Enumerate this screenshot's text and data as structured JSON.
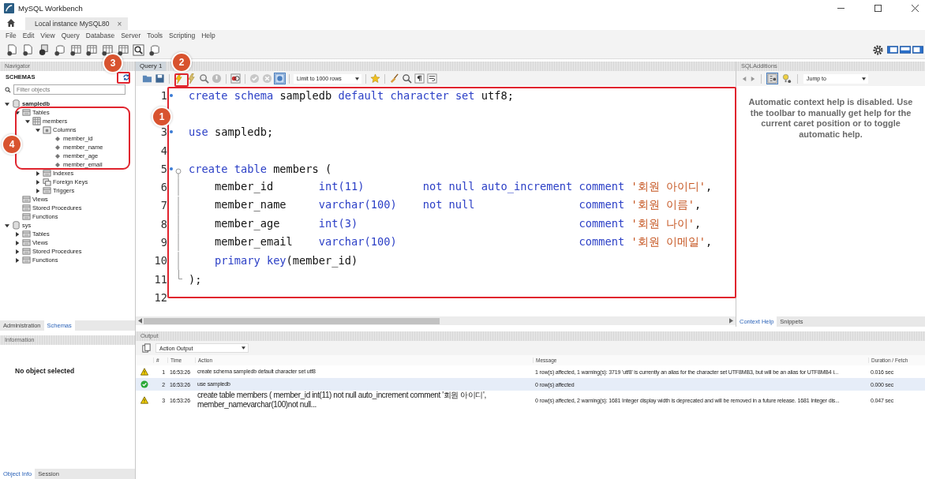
{
  "window": {
    "title": "MySQL Workbench"
  },
  "connection_tabs": [
    {
      "label": "Local instance MySQL80",
      "close": "×",
      "selected": true
    }
  ],
  "menu": [
    "File",
    "Edit",
    "View",
    "Query",
    "Database",
    "Server",
    "Tools",
    "Scripting",
    "Help"
  ],
  "navigator": {
    "title": "Navigator",
    "section": "SCHEMAS",
    "filter": {
      "placeholder": "Filter objects"
    },
    "tree": [
      {
        "label": "sampledb",
        "kind": "schema",
        "active": true,
        "expanded": true,
        "children": [
          {
            "label": "Tables",
            "kind": "folder",
            "expanded": true,
            "children": [
              {
                "label": "members",
                "kind": "table",
                "expanded": true,
                "children": [
                  {
                    "label": "Columns",
                    "kind": "columns",
                    "expanded": true,
                    "children": [
                      {
                        "label": "member_id",
                        "kind": "column"
                      },
                      {
                        "label": "member_name",
                        "kind": "column"
                      },
                      {
                        "label": "member_age",
                        "kind": "column"
                      },
                      {
                        "label": "member_email",
                        "kind": "column"
                      }
                    ]
                  },
                  {
                    "label": "Indexes",
                    "kind": "folder",
                    "expanded": false
                  },
                  {
                    "label": "Foreign Keys",
                    "kind": "keys",
                    "expanded": false
                  },
                  {
                    "label": "Triggers",
                    "kind": "folder",
                    "expanded": false
                  }
                ]
              }
            ]
          },
          {
            "label": "Views",
            "kind": "folder"
          },
          {
            "label": "Stored Procedures",
            "kind": "folder"
          },
          {
            "label": "Functions",
            "kind": "folder"
          }
        ]
      },
      {
        "label": "sys",
        "kind": "schema",
        "active": false,
        "expanded": true,
        "children": [
          {
            "label": "Tables",
            "kind": "folder",
            "expanded": false
          },
          {
            "label": "Views",
            "kind": "folder",
            "expanded": false
          },
          {
            "label": "Stored Procedures",
            "kind": "folder",
            "expanded": false
          },
          {
            "label": "Functions",
            "kind": "folder",
            "expanded": false
          }
        ]
      }
    ],
    "tabs": [
      {
        "label": "Administration",
        "selected": false
      },
      {
        "label": "Schemas",
        "selected": true
      }
    ]
  },
  "information": {
    "title": "Information",
    "message": "No object selected",
    "tabs": [
      {
        "label": "Object Info",
        "selected": true
      },
      {
        "label": "Session",
        "selected": false
      }
    ]
  },
  "editor": {
    "tab": "Query 1",
    "limit": "Limit to 1000 rows",
    "lines": [
      {
        "number": "1",
        "marker": true,
        "kind": "plain",
        "segments": [
          {
            "text": "create schema",
            "kind": "keyword"
          },
          {
            "text": " sampledb ",
            "kind": "plain"
          },
          {
            "text": "default character set",
            "kind": "keyword"
          },
          {
            "text": " utf8;",
            "kind": "plain"
          }
        ]
      },
      {
        "marker": false,
        "kind": "plain"
      },
      {
        "number": "3",
        "marker": true,
        "kind": "plain",
        "segments": [
          {
            "text": "use",
            "kind": "keyword"
          },
          {
            "text": " sampledb;",
            "kind": "plain"
          }
        ]
      },
      {
        "number": "4",
        "marker": false,
        "kind": "plain"
      },
      {
        "number": "5",
        "marker": true,
        "kind": "fold_start",
        "segments": [
          {
            "text": "create table",
            "kind": "keyword"
          },
          {
            "text": " members (",
            "kind": "plain"
          }
        ]
      },
      {
        "number": "6",
        "marker": false,
        "kind": "fold_body",
        "segments": [
          {
            "text": "    member_id       ",
            "kind": "plain"
          },
          {
            "text": "int(11)         not null auto_increment comment ",
            "kind": "keyword"
          },
          {
            "text": "'회원 아이디'",
            "kind": "string"
          },
          {
            "text": ",",
            "kind": "plain"
          }
        ]
      },
      {
        "number": "7",
        "marker": false,
        "kind": "fold_body",
        "segments": [
          {
            "text": "    member_name     ",
            "kind": "plain"
          },
          {
            "text": "varchar(100)    not null                comment ",
            "kind": "keyword"
          },
          {
            "text": "'회원 이름'",
            "kind": "string"
          },
          {
            "text": ",",
            "kind": "plain"
          }
        ]
      },
      {
        "number": "8",
        "marker": false,
        "kind": "fold_body",
        "segments": [
          {
            "text": "    member_age      ",
            "kind": "plain"
          },
          {
            "text": "int(3)                                  comment ",
            "kind": "keyword"
          },
          {
            "text": "'회원 나이'",
            "kind": "string"
          },
          {
            "text": ",",
            "kind": "plain"
          }
        ]
      },
      {
        "number": "9",
        "marker": false,
        "kind": "fold_body",
        "segments": [
          {
            "text": "    member_email    ",
            "kind": "plain"
          },
          {
            "text": "varchar(100)                            comment ",
            "kind": "keyword"
          },
          {
            "text": "'회원 이메일'",
            "kind": "string"
          },
          {
            "text": ",",
            "kind": "plain"
          }
        ]
      },
      {
        "number": "10",
        "marker": false,
        "kind": "fold_body",
        "segments": [
          {
            "text": "    primary key",
            "kind": "keyword"
          },
          {
            "text": "(member_id)",
            "kind": "plain"
          }
        ]
      },
      {
        "number": "11",
        "marker": false,
        "kind": "fold_end",
        "segments": [
          {
            "text": ");",
            "kind": "plain"
          }
        ]
      },
      {
        "number": "12",
        "marker": false,
        "kind": "plain"
      }
    ]
  },
  "output": {
    "title": "Output",
    "mode": "Action Output",
    "columns": [
      "#",
      "Time",
      "Action",
      "Message",
      "Duration / Fetch"
    ],
    "rows": [
      {
        "kind": "warning",
        "selected": false,
        "number": "1",
        "time": "16:53:26",
        "action": "create schema sampledb default character set utf8",
        "message": "1 row(s) affected, 1 warning(s): 3719 'utf8' is currently an alias for the character set UTF8MB3, but will be an alias for UTF8MB4 i...",
        "duration": "0.016 sec"
      },
      {
        "kind": "ok",
        "selected": true,
        "number": "2",
        "time": "16:53:26",
        "action": "use sampledb",
        "message": "0 row(s) affected",
        "duration": "0.000 sec"
      },
      {
        "kind": "warning",
        "selected": false,
        "number": "3",
        "time": "16:53:26",
        "action": "create table members ( member_id int(11) not null auto_increment comment '회원 아이디',        member_namevarchar(100)not null...",
        "message": "0 row(s) affected, 2 warning(s): 1681 Integer display width is deprecated and will be removed in a future release. 1681 Integer dis...",
        "duration": "0.047 sec"
      }
    ]
  },
  "sql_additions": {
    "title": "SQLAdditions",
    "jump": "Jump to",
    "help": "Automatic context help is disabled. Use the toolbar to manually get help for the current caret position or to toggle automatic help.",
    "tabs": [
      {
        "label": "Context Help",
        "selected": true
      },
      {
        "label": "Snippets",
        "selected": false
      }
    ]
  },
  "annotations": [
    {
      "label": "1"
    },
    {
      "label": "2"
    },
    {
      "label": "3"
    },
    {
      "label": "4"
    }
  ]
}
